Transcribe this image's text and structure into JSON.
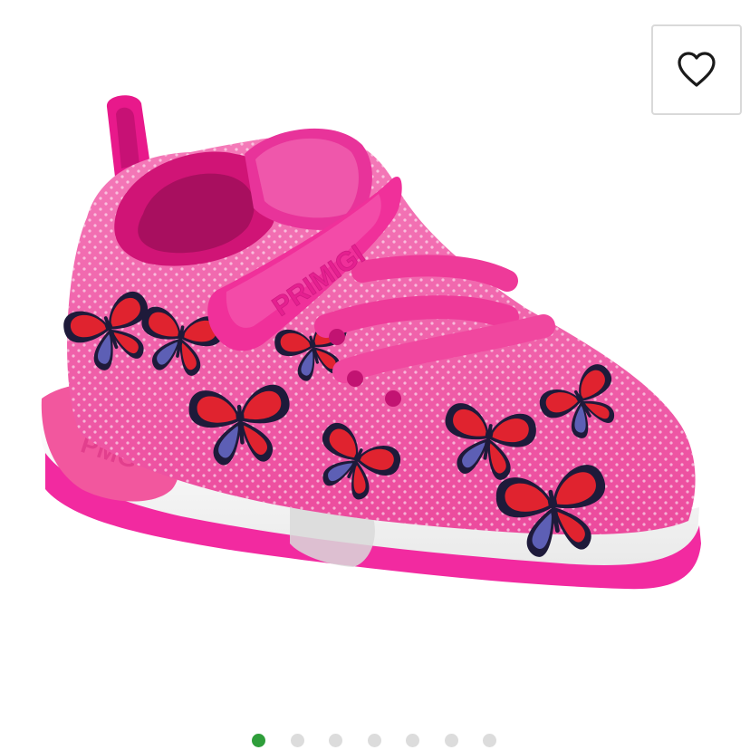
{
  "product": {
    "image_alt": "Pink butterfly-print kids sneaker with hook-and-loop strap",
    "brand_on_strap": "PRIMIGI",
    "heel_logo": "PMG"
  },
  "wishlist": {
    "icon": "heart-outline-icon"
  },
  "carousel": {
    "total": 7,
    "active_index": 0,
    "active_color": "#2e9e3a",
    "inactive_color": "#dcdcdc"
  },
  "colors": {
    "shoe_pink": "#f25aa6",
    "shoe_magenta": "#e8198b",
    "butterfly_red": "#e0232f",
    "butterfly_navy": "#1e1a3a",
    "sole_white": "#f7f7f7"
  }
}
